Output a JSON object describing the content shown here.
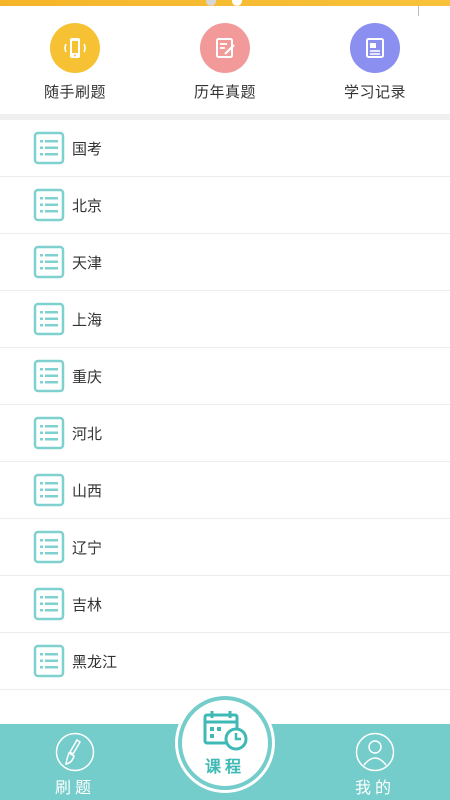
{
  "quick_actions": [
    {
      "label": "随手刷题",
      "icon": "phone-icon",
      "color": "#f6c233"
    },
    {
      "label": "历年真题",
      "icon": "exam-paper-icon",
      "color": "#f29a9a"
    },
    {
      "label": "学习记录",
      "icon": "record-icon",
      "color": "#8a8ff0"
    }
  ],
  "regions": [
    {
      "label": "国考",
      "icon": "list-icon"
    },
    {
      "label": "北京",
      "icon": "list-icon"
    },
    {
      "label": "天津",
      "icon": "list-icon"
    },
    {
      "label": "上海",
      "icon": "list-icon"
    },
    {
      "label": "重庆",
      "icon": "list-icon"
    },
    {
      "label": "河北",
      "icon": "list-icon"
    },
    {
      "label": "山西",
      "icon": "list-icon"
    },
    {
      "label": "辽宁",
      "icon": "list-icon"
    },
    {
      "label": "吉林",
      "icon": "list-icon"
    },
    {
      "label": "黑龙江",
      "icon": "list-icon"
    }
  ],
  "tabbar": {
    "left_label": "刷题",
    "center_label": "课程",
    "right_label": "我的",
    "color": "#74cccb"
  },
  "colors": {
    "accent": "#74cccb",
    "list_icon": "#7fd1cf",
    "top_bar": "#f5b52a"
  }
}
